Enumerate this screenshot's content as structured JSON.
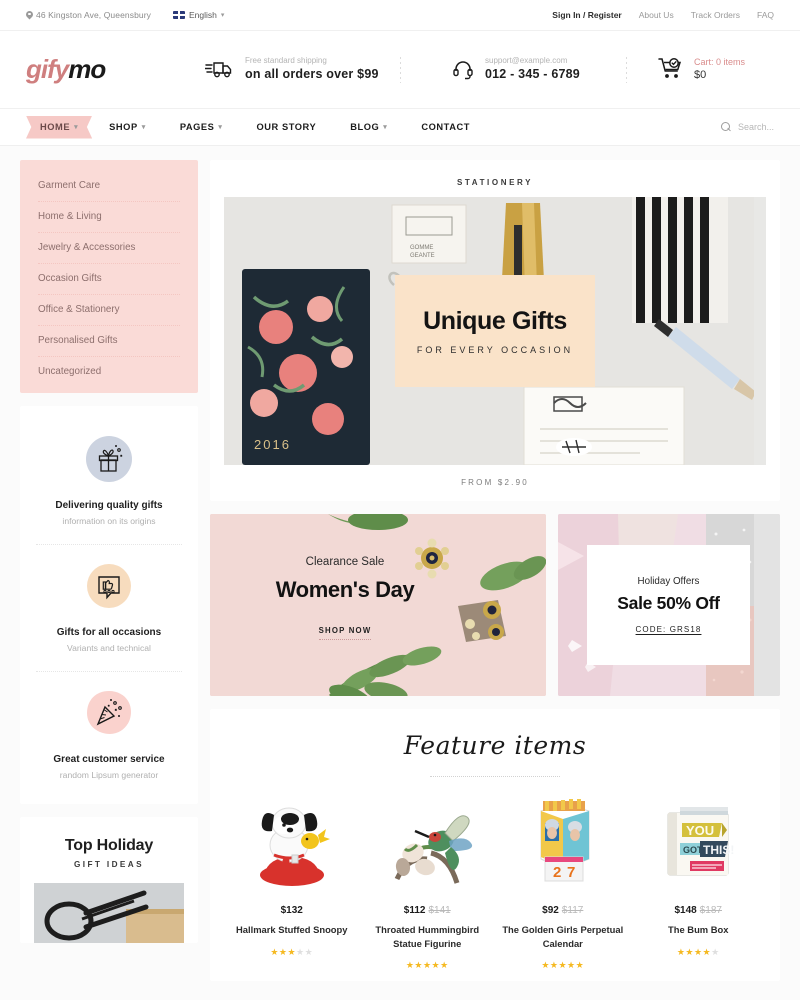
{
  "topbar": {
    "address": "46 Kingston Ave, Queensbury",
    "language": "English",
    "links": [
      {
        "label": "Sign In / Register",
        "strong": true
      },
      {
        "label": "About Us",
        "strong": false
      },
      {
        "label": "Track Orders",
        "strong": false
      },
      {
        "label": "FAQ",
        "strong": false
      }
    ]
  },
  "header": {
    "logo_part1": "gify",
    "logo_part2": "mo",
    "shipping": {
      "line1": "Free standard shipping",
      "line2": "on all orders over $99"
    },
    "support": {
      "line1": "support@example.com",
      "line2": "012 - 345 - 6789"
    },
    "cart": {
      "label": "Cart:",
      "items": "0 items",
      "total": "$0"
    }
  },
  "nav": {
    "items": [
      {
        "label": "HOME",
        "caret": true,
        "active": true
      },
      {
        "label": "SHOP",
        "caret": true,
        "active": false
      },
      {
        "label": "PAGES",
        "caret": true,
        "active": false
      },
      {
        "label": "OUR STORY",
        "caret": false,
        "active": false
      },
      {
        "label": "BLOG",
        "caret": true,
        "active": false
      },
      {
        "label": "CONTACT",
        "caret": false,
        "active": false
      }
    ],
    "search_placeholder": "Search..."
  },
  "sidebar": {
    "categories": [
      "Garment Care",
      "Home & Living",
      "Jewelry & Accessories",
      "Occasion Gifts",
      "Office & Stationery",
      "Personalised Gifts",
      "Uncategorized"
    ],
    "services": [
      {
        "icon": "gift-box-icon",
        "title": "Delivering quality gifts",
        "sub": "information on its origins",
        "bg": "#ccd3e0"
      },
      {
        "icon": "thumbs-up-chat-icon",
        "title": "Gifts for all occasions",
        "sub": "Variants and technical",
        "bg": "#f7dcbe"
      },
      {
        "icon": "party-popper-icon",
        "title": "Great customer service",
        "sub": "random Lipsum generator",
        "bg": "#fad2cd"
      }
    ],
    "holiday": {
      "title": "Top Holiday",
      "subtitle": "GIFT IDEAS"
    }
  },
  "hero": {
    "kicker": "STATIONERY",
    "title": "Unique Gifts",
    "subtitle": "FOR EVERY OCCASION",
    "footer": "FROM $2.90"
  },
  "promos": {
    "left": {
      "kicker": "Clearance Sale",
      "title": "Women's Day",
      "cta": "SHOP NOW"
    },
    "right": {
      "kicker": "Holiday Offers",
      "title": "Sale 50% Off",
      "code": "CODE: GRS18"
    }
  },
  "features": {
    "title": "Feature items",
    "products": [
      {
        "price": "$132",
        "old_price": "",
        "name": "Hallmark Stuffed Snoopy",
        "rating": 3
      },
      {
        "price": "$112",
        "old_price": "$141",
        "name": "Throated Hummingbird Statue Figurine",
        "rating": 4.5
      },
      {
        "price": "$92",
        "old_price": "$117",
        "name": "The Golden Girls Perpetual Calendar",
        "rating": 5
      },
      {
        "price": "$148",
        "old_price": "$187",
        "name": "The Bum Box",
        "rating": 4
      }
    ]
  },
  "colors": {
    "accent_pink": "#d98c8c",
    "banner_pink": "#f6c9c6",
    "category_bg": "#fadbd7",
    "star": "#f5b921"
  }
}
